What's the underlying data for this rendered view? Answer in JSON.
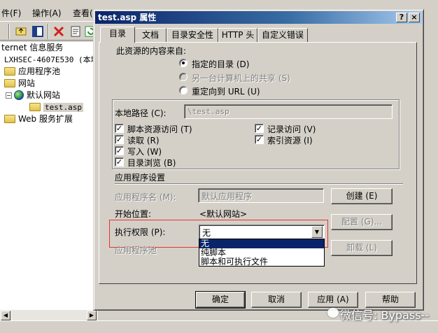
{
  "background_window": {
    "menu": {
      "file": "件(F)",
      "action": "操作(A)",
      "view": "查看("
    },
    "tree": {
      "root": "ternet 信息服务",
      "server": "LXHSEC-4607E530 (本地计",
      "app_pools": "应用程序池",
      "websites": "网站",
      "default_site": "默认网站",
      "file": "test.asp",
      "web_ext": "Web 服务扩展"
    }
  },
  "dialog": {
    "title": "test.asp 属性",
    "help_btn": "?",
    "close_btn": "×",
    "tabs": [
      "目录",
      "文档",
      "目录安全性",
      "HTTP 头",
      "自定义错误"
    ],
    "content_source_label": "此资源的内容来自:",
    "radio_dir": "指定的目录 (D)",
    "radio_share": "另一台计算机上的共享 (S)",
    "radio_url": "重定向到 URL (U)",
    "local_path_label": "本地路径 (C):",
    "local_path_value": "\\test.asp",
    "cb_script_access": "脚本资源访问 (T)",
    "cb_read": "读取 (R)",
    "cb_write": "写入 (W)",
    "cb_dir_browse": "目录浏览 (B)",
    "cb_log_visits": "记录访问 (V)",
    "cb_index": "索引资源 (I)",
    "app_settings_label": "应用程序设置",
    "app_name_label": "应用程序名 (M):",
    "app_name_value": "默认应用程序",
    "create_btn": "创建 (E)",
    "start_pos_label": "开始位置:",
    "start_pos_value": "<默认网站>",
    "config_btn": "配置 (G)...",
    "exec_perm_label": "执行权限 (P):",
    "exec_perm_value": "无",
    "exec_perm_options": [
      "无",
      "纯脚本",
      "脚本和可执行文件"
    ],
    "app_pool_label": "应用程序池",
    "unload_btn": "卸载 (L)",
    "ok_btn": "确定",
    "cancel_btn": "取消",
    "apply_btn": "应用 (A)",
    "help_btn2": "帮助"
  },
  "watermark": "微信号: Bypass--",
  "icons": [
    "folder-icon",
    "globe-icon",
    "drop-arrow-icon",
    "check-icon"
  ]
}
